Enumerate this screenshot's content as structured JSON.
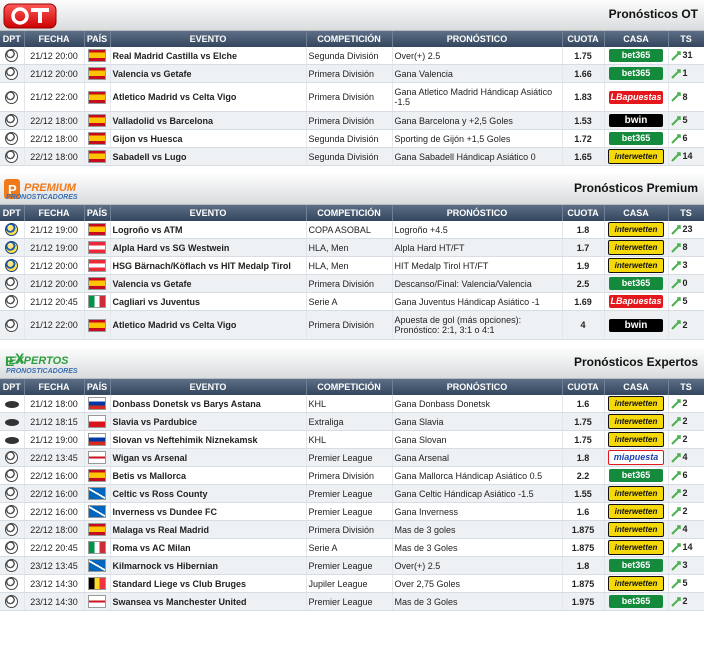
{
  "headers": {
    "dpt": "DPT",
    "fecha": "FECHA",
    "pais": "PAÍS",
    "evento": "EVENTO",
    "competicion": "COMPETICIÓN",
    "pronostico": "PRONÓSTICO",
    "cuota": "CUOTA",
    "casa": "CASA",
    "ts": "TS"
  },
  "sections": [
    {
      "title": "Pronósticos OT",
      "logo": "OT",
      "rows": [
        {
          "sport": "football",
          "fecha": "21/12 20:00",
          "flag": "ES",
          "evento": "Real Madrid Castilla vs Elche",
          "competicion": "Segunda División",
          "pronostico": "Over(+) 2.5",
          "cuota": "1.75",
          "casa": "bet365",
          "ts": "31"
        },
        {
          "sport": "football",
          "fecha": "21/12 20:00",
          "flag": "ES",
          "evento": "Valencia vs Getafe",
          "competicion": "Primera División",
          "pronostico": "Gana Valencia",
          "cuota": "1.66",
          "casa": "bet365",
          "ts": "1"
        },
        {
          "sport": "football",
          "fecha": "21/12 22:00",
          "flag": "ES",
          "evento": "Atletico Madrid vs Celta Vigo",
          "competicion": "Primera División",
          "pronostico": "Gana Atletico Madrid Hándicap Asiático -1.5",
          "cuota": "1.83",
          "casa": "apuestas",
          "ts": "8",
          "tall": true
        },
        {
          "sport": "football",
          "fecha": "22/12 18:00",
          "flag": "ES",
          "evento": "Valladolid vs Barcelona",
          "competicion": "Primera División",
          "pronostico": "Gana Barcelona y +2,5 Goles",
          "cuota": "1.53",
          "casa": "bwin",
          "ts": "5"
        },
        {
          "sport": "football",
          "fecha": "22/12 18:00",
          "flag": "ES",
          "evento": "Gijon vs Huesca",
          "competicion": "Segunda División",
          "pronostico": "Sporting de Gijón +1,5 Goles",
          "cuota": "1.72",
          "casa": "bet365",
          "ts": "6"
        },
        {
          "sport": "football",
          "fecha": "22/12 18:00",
          "flag": "ES",
          "evento": "Sabadell vs Lugo",
          "competicion": "Segunda División",
          "pronostico": "Gana Sabadell Hándicap Asiático 0",
          "cuota": "1.65",
          "casa": "interwetten",
          "ts": "14"
        }
      ]
    },
    {
      "title": "Pronósticos Premium",
      "logo": "PREMIUM",
      "logo_sub": "PRONOSTICADORES",
      "rows": [
        {
          "sport": "handball",
          "fecha": "21/12 19:00",
          "flag": "ES",
          "evento": "Logroño vs ATM",
          "competicion": "COPA ASOBAL",
          "pronostico": "Logroño +4.5",
          "cuota": "1.8",
          "casa": "interwetten",
          "ts": "23"
        },
        {
          "sport": "handball",
          "fecha": "21/12 19:00",
          "flag": "AT",
          "evento": "Alpla Hard vs SG Westwein",
          "competicion": "HLA, Men",
          "pronostico": "Alpla Hard HT/FT",
          "cuota": "1.7",
          "casa": "interwetten",
          "ts": "8"
        },
        {
          "sport": "handball",
          "fecha": "21/12 20:00",
          "flag": "AT",
          "evento": "HSG Bärnach/Köflach vs HIT Medalp Tirol",
          "competicion": "HLA, Men",
          "pronostico": "HIT Medalp Tirol HT/FT",
          "cuota": "1.9",
          "casa": "interwetten",
          "ts": "3"
        },
        {
          "sport": "football",
          "fecha": "21/12 20:00",
          "flag": "ES",
          "evento": "Valencia vs Getafe",
          "competicion": "Primera División",
          "pronostico": "Descanso/Final: Valencia/Valencia",
          "cuota": "2.5",
          "casa": "bet365",
          "ts": "0"
        },
        {
          "sport": "football",
          "fecha": "21/12 20:45",
          "flag": "IT",
          "evento": "Cagliari vs Juventus",
          "competicion": "Serie A",
          "pronostico": "Gana Juventus Hándicap Asiático -1",
          "cuota": "1.69",
          "casa": "apuestas",
          "ts": "5"
        },
        {
          "sport": "football",
          "fecha": "21/12 22:00",
          "flag": "ES",
          "evento": "Atletico Madrid vs Celta Vigo",
          "competicion": "Primera División",
          "pronostico": "Apuesta de gol (más opciones): Pronóstico: 2:1, 3:1 o 4:1",
          "cuota": "4",
          "casa": "bwin",
          "ts": "2",
          "tall": true
        }
      ]
    },
    {
      "title": "Pronósticos Expertos",
      "logo": "EXPERTOS",
      "logo_sub": "PRONOSTICADORES",
      "rows": [
        {
          "sport": "hockey",
          "fecha": "21/12 18:00",
          "flag": "RU",
          "evento": "Donbass Donetsk vs Barys Astana",
          "competicion": "KHL",
          "pronostico": "Gana Donbass Donetsk",
          "cuota": "1.6",
          "casa": "interwetten",
          "ts": "2"
        },
        {
          "sport": "hockey",
          "fecha": "21/12 18:15",
          "flag": "CZ",
          "evento": "Slavia vs Pardubice",
          "competicion": "Extraliga",
          "pronostico": "Gana Slavia",
          "cuota": "1.75",
          "casa": "interwetten",
          "ts": "2"
        },
        {
          "sport": "hockey",
          "fecha": "21/12 19:00",
          "flag": "RU",
          "evento": "Slovan vs Neftehimik Niznekamsk",
          "competicion": "KHL",
          "pronostico": "Gana Slovan",
          "cuota": "1.75",
          "casa": "interwetten",
          "ts": "2"
        },
        {
          "sport": "football",
          "fecha": "22/12 13:45",
          "flag": "EN",
          "evento": "Wigan vs Arsenal",
          "competicion": "Premier League",
          "pronostico": "Gana Arsenal",
          "cuota": "1.8",
          "casa": "miapuesta",
          "ts": "4"
        },
        {
          "sport": "football",
          "fecha": "22/12 16:00",
          "flag": "ES",
          "evento": "Betis vs Mallorca",
          "competicion": "Primera División",
          "pronostico": "Gana Mallorca Hándicap Asiático 0.5",
          "cuota": "2.2",
          "casa": "bet365",
          "ts": "6"
        },
        {
          "sport": "football",
          "fecha": "22/12 16:00",
          "flag": "SC",
          "evento": "Celtic vs Ross County",
          "competicion": "Premier League",
          "pronostico": "Gana Celtic Hándicap Asiático -1.5",
          "cuota": "1.55",
          "casa": "interwetten",
          "ts": "2"
        },
        {
          "sport": "football",
          "fecha": "22/12 16:00",
          "flag": "SC",
          "evento": "Inverness vs Dundee FC",
          "competicion": "Premier League",
          "pronostico": "Gana Inverness",
          "cuota": "1.6",
          "casa": "interwetten",
          "ts": "2"
        },
        {
          "sport": "football",
          "fecha": "22/12 18:00",
          "flag": "ES",
          "evento": "Malaga vs Real Madrid",
          "competicion": "Primera División",
          "pronostico": "Mas de 3 goles",
          "cuota": "1.875",
          "casa": "interwetten",
          "ts": "4"
        },
        {
          "sport": "football",
          "fecha": "22/12 20:45",
          "flag": "IT",
          "evento": "Roma vs AC Milan",
          "competicion": "Serie A",
          "pronostico": "Mas de 3 Goles",
          "cuota": "1.875",
          "casa": "interwetten",
          "ts": "14"
        },
        {
          "sport": "football",
          "fecha": "23/12 13:45",
          "flag": "SC",
          "evento": "Kilmarnock vs Hibernian",
          "competicion": "Premier League",
          "pronostico": "Over(+) 2.5",
          "cuota": "1.8",
          "casa": "bet365",
          "ts": "3"
        },
        {
          "sport": "football",
          "fecha": "23/12 14:30",
          "flag": "BE",
          "evento": "Standard Liege vs Club Bruges",
          "competicion": "Jupiler League",
          "pronostico": "Over 2,75 Goles",
          "cuota": "1.875",
          "casa": "interwetten",
          "ts": "5"
        },
        {
          "sport": "football",
          "fecha": "23/12 14:30",
          "flag": "EN",
          "evento": "Swansea vs Manchester United",
          "competicion": "Premier League",
          "pronostico": "Mas de 3 Goles",
          "cuota": "1.975",
          "casa": "bet365",
          "ts": "2"
        }
      ]
    }
  ],
  "bookmakers": {
    "bet365": "bet365",
    "bwin": "bwin",
    "interwetten": "interwetten",
    "apuestas": "LBapuestas",
    "miapuesta": "miapuesta"
  },
  "colors": {
    "header_bg": "#3f5169",
    "row_alt": "#eef1f4",
    "ts_icon": "#4caf50",
    "bet365": "#148a3c",
    "interwetten": "#f5d90a",
    "apuestas": "#e3171c"
  }
}
